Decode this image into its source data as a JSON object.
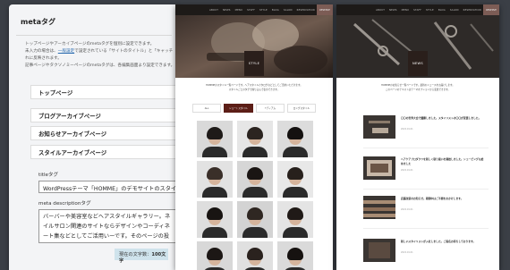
{
  "admin": {
    "title": "metaタグ",
    "description_lines": [
      "トップページやアーカイブページのmetaタグを個別に設定できます。",
      "未入力の場合は、一般設定で設定されている「サイトのタイトル」と「キャッチフレーズ」がそれぞ",
      "れに反映されます。",
      "記事ページやタクソノミーページのmetaタグは、各編集画面より設定できます。"
    ],
    "desc_link": "一般設定",
    "sections": [
      "トップページ",
      "ブログアーカイブページ",
      "お知らせアーカイブページ",
      "スタイルアーカイブページ"
    ],
    "title_tag_label": "titleタグ",
    "title_tag_value": "WordPressテーマ「HOMME」のデモサイトのスタイルの一覧",
    "meta_desc_label": "meta descriptionタグ",
    "meta_desc_value": "バーバーや美容室などヘアスタイルギャラリー。ネイルサロン関連のサイトならデザインやコーディネート集などとしてご活用いーです。そのページの投稿者（スタッフ）と紐付けできる点",
    "counter_prefix": "現在の文字数：",
    "counter_value": "100文字"
  },
  "style_site": {
    "nav": [
      "ABOUT",
      "NEWS",
      "MENU",
      "STAFF",
      "STYLE",
      "BLOG",
      "SALON",
      "RESERVATION"
    ],
    "nav_right": "RESERVE",
    "hero_label": "STYLE",
    "intro_lines": [
      "HOMMEのスタイル一覧ページです。ヘアスタイルカタログなどとしてご活用いただけます。",
      "スタイルごとのタグで絞り込んで表示できます。"
    ],
    "categories": [
      "ALL",
      "ショートスタイル",
      "ミディアム",
      "ロングスタイル"
    ],
    "active_category": 1
  },
  "news_site": {
    "nav": [
      "ABOUT",
      "NEWS",
      "MENU",
      "STAFF",
      "STYLE",
      "BLOG",
      "SALON",
      "RESERVATION"
    ],
    "nav_right": "RESERVE",
    "hero_label": "NEWS",
    "intro_lines": [
      "HOMMEのお知らせ一覧ページです。最新のニュースをお届けします。",
      "このページのテキストはテーマオプションから変更できます。"
    ],
    "items": [
      {
        "title": "〇〇の世界大会で優勝しました。スタイリストの〇〇が受賞しました。",
        "date": "2022.01.01"
      },
      {
        "title": "ヘアケアプロダクツを新しく取り扱いを開始しました。シェービングも始めました",
        "date": "2022.01.01"
      },
      {
        "title": "店舗改装のお知らせ。期間中はご不便をおかけします。",
        "date": "2022.01.01"
      },
      {
        "title": "新しいスタイリストが入社しました。ご指名お待ちしております。",
        "date": "2022.01.01"
      }
    ]
  },
  "colors": {
    "accent": "#5c1e17",
    "topbar": "#1d1a18",
    "reserve": "#7c5c55"
  }
}
